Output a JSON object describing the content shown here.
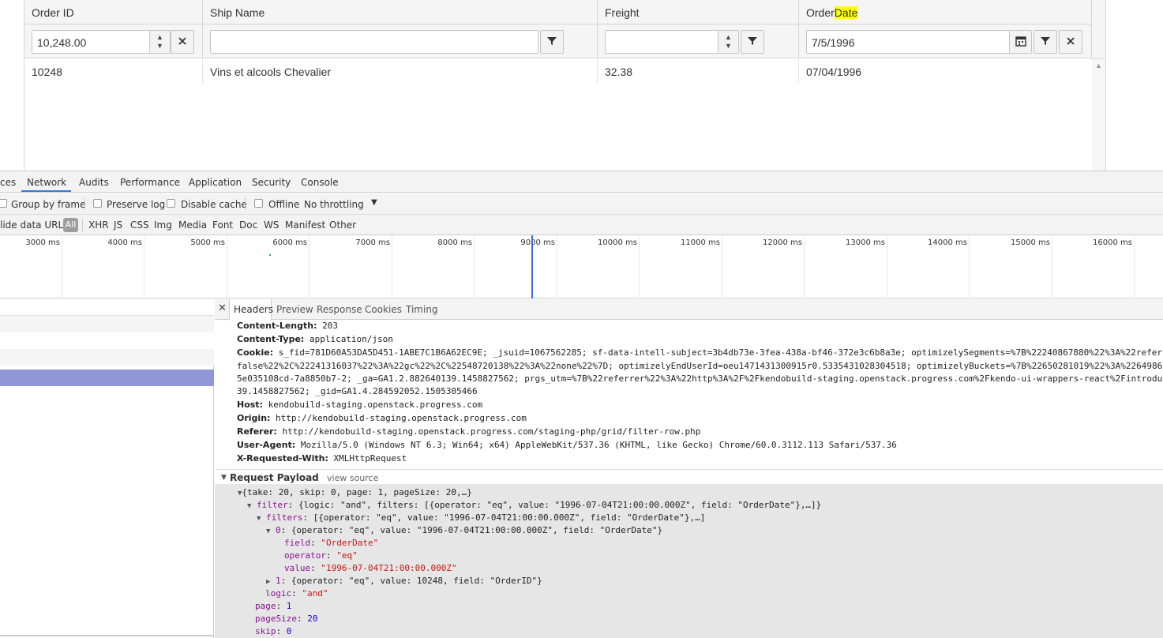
{
  "grid": {
    "columns": [
      {
        "header": "Order ID"
      },
      {
        "header": "Ship Name"
      },
      {
        "header": "Freight"
      },
      {
        "header_prefix": "Order",
        "header_highlight": "Date"
      }
    ],
    "filters": {
      "order_id_value": "10,248.00",
      "ship_name_value": "",
      "freight_value": "",
      "order_date_value": "7/5/1996"
    },
    "rows": [
      {
        "order_id": "10248",
        "ship_name": "Vins et alcools Chevalier",
        "freight": "32.38",
        "order_date": "07/04/1996"
      }
    ]
  },
  "devtools": {
    "tabs": [
      "ces",
      "Network",
      "Audits",
      "Performance",
      "Application",
      "Security",
      "Console"
    ],
    "active_tab": "Network",
    "toolbar1": {
      "group_by_frame": "Group by frame",
      "preserve_log": "Preserve log",
      "disable_cache": "Disable cache",
      "offline": "Offline",
      "throttling": "No throttling"
    },
    "toolbar2": {
      "hide_data_urls": "lide data URLs",
      "all": "All",
      "types": [
        "XHR",
        "JS",
        "CSS",
        "Img",
        "Media",
        "Font",
        "Doc",
        "WS",
        "Manifest",
        "Other"
      ]
    },
    "timeline_labels": [
      "3000 ms",
      "4000 ms",
      "5000 ms",
      "6000 ms",
      "7000 ms",
      "8000 ms",
      "9000 ms",
      "10000 ms",
      "11000 ms",
      "12000 ms",
      "13000 ms",
      "14000 ms",
      "15000 ms",
      "16000 ms"
    ],
    "detail_tabs": [
      "Headers",
      "Preview",
      "Response",
      "Cookies",
      "Timing"
    ],
    "active_detail_tab": "Headers",
    "headers": [
      {
        "name": "Content-Length:",
        "value": "203"
      },
      {
        "name": "Content-Type:",
        "value": "application/json"
      },
      {
        "name": "Cookie:",
        "value": "s_fid=781D60A53DA5D451-1ABE7C1B6A62EC9E; _jsuid=1067562285; sf-data-intell-subject=3b4db73e-3fea-438a-bf46-372e3c6b8a3e; optimizelySegments=%7B%22240867880%22%3A%22referra"
      },
      {
        "name": "",
        "value": "false%22%2C%22241316037%22%3A%22gc%22%2C%22548720138%22%3A%22none%22%7D; optimizelyEndUserId=oeu1471431300915r0.5335431028304518; optimizelyBuckets=%7B%22650281019%22%3A%2264986"
      },
      {
        "name": "",
        "value": "5e035108cd-7a8850b7-2; _ga=GA1.2.882640139.1458827562; prgs_utm=%7B%22referrer%22%3A%22http%3A%2F%2Fkendobuild-staging.openstack.progress.com%2Fkendo-ui-wrappers-react%2Fintroduc"
      },
      {
        "name": "",
        "value": "39.1458827562; _gid=GA1.4.284592052.1505305466"
      },
      {
        "name": "Host:",
        "value": "kendobuild-staging.openstack.progress.com"
      },
      {
        "name": "Origin:",
        "value": "http://kendobuild-staging.openstack.progress.com"
      },
      {
        "name": "Referer:",
        "value": "http://kendobuild-staging.openstack.progress.com/staging-php/grid/filter-row.php"
      },
      {
        "name": "User-Agent:",
        "value": "Mozilla/5.0 (Windows NT 6.3; Win64; x64) AppleWebKit/537.36 (KHTML, like Gecko) Chrome/60.0.3112.113 Safari/537.36"
      },
      {
        "name": "X-Requested-With:",
        "value": "XMLHttpRequest"
      }
    ],
    "payload": {
      "title": "Request Payload",
      "view_source": "view source",
      "root": "{take: 20, skip: 0, page: 1, pageSize: 20,…}",
      "filter_key": "filter",
      "filter_summary": "{logic: \"and\", filters: [{operator: \"eq\", value: \"1996-07-04T21:00:00.000Z\", field: \"OrderDate\"},…]}",
      "filters_key": "filters",
      "filters_summary": "[{operator: \"eq\", value: \"1996-07-04T21:00:00.000Z\", field: \"OrderDate\"},…]",
      "item0_key": "0",
      "item0_summary": "{operator: \"eq\", value: \"1996-07-04T21:00:00.000Z\", field: \"OrderDate\"}",
      "field_key": "field",
      "field_val": "\"OrderDate\"",
      "operator_key": "operator",
      "operator_val": "\"eq\"",
      "value_key": "value",
      "value_val": "\"1996-07-04T21:00:00.000Z\"",
      "item1_key": "1",
      "item1_summary": "{operator: \"eq\", value: 10248, field: \"OrderID\"}",
      "logic_key": "logic",
      "logic_val": "\"and\"",
      "page_key": "page",
      "page_val": "1",
      "pagesize_key": "pageSize",
      "pagesize_val": "20",
      "skip_key": "skip",
      "skip_val": "0"
    }
  }
}
